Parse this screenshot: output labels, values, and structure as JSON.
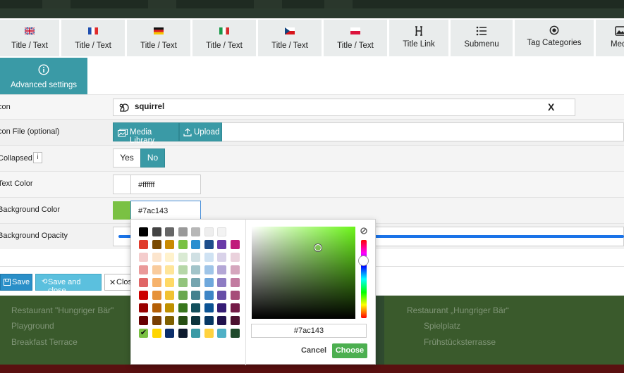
{
  "tabs": [
    {
      "label": "Title / Text",
      "icon": "flag-uk-icon"
    },
    {
      "label": "Title / Text",
      "icon": "flag-fr-icon"
    },
    {
      "label": "Title / Text",
      "icon": "flag-de-icon"
    },
    {
      "label": "Title / Text",
      "icon": "flag-it-icon"
    },
    {
      "label": "Title / Text",
      "icon": "flag-cz-icon"
    },
    {
      "label": "Title / Text",
      "icon": "flag-pl-icon"
    },
    {
      "label": "Title Link",
      "icon": "heading-icon"
    },
    {
      "label": "Submenu",
      "icon": "list-icon"
    },
    {
      "label": "Tag Categories",
      "icon": "dot-circle-icon"
    },
    {
      "label": "Med",
      "icon": "image-icon"
    }
  ],
  "advanced_tab": {
    "label": "Advanced settings",
    "icon": "info-icon"
  },
  "form": {
    "icon": {
      "label": "con",
      "value": "squirrel",
      "clear": "X"
    },
    "icon_file": {
      "label": "con File (optional)",
      "media_library": "Media Library",
      "upload": "Upload"
    },
    "collapsed": {
      "label": "Collapsed",
      "info": "i",
      "yes": "Yes",
      "no": "No",
      "selected": "No"
    },
    "text_color": {
      "label": "Text Color",
      "value": "#ffffff"
    },
    "background_color": {
      "label": "Background Color",
      "value": "#7ac143"
    },
    "background_opacity": {
      "label": "Background Opacity"
    }
  },
  "footer": {
    "save": "Save",
    "save_close": "Save and close",
    "close": "Close"
  },
  "picker": {
    "hex_value": "#7ac143",
    "cancel": "Cancel",
    "choose": "Choose",
    "clear_icon": "no-color-icon",
    "palette": [
      [
        "#000000",
        "#434343",
        "#666666",
        "#999999",
        "#b7b7b7",
        "#eeeeee",
        "#f3f3f3"
      ],
      [
        "#e03b2b",
        "#7a4a00",
        "#c98a00",
        "#7ac143",
        "#2a8fd0",
        "#1e4e8c",
        "#6a3aa8",
        "#c01a7a"
      ],
      [
        "#f4cccc",
        "#fce5cd",
        "#fff2cc",
        "#d9ead3",
        "#d0e0e3",
        "#cfe2f3",
        "#d9d2e9",
        "#ead1dc"
      ],
      [
        "#ea9999",
        "#f9cb9c",
        "#ffe599",
        "#b6d7a8",
        "#a2c4c9",
        "#9fc5e8",
        "#b4a7d6",
        "#d5a6bd"
      ],
      [
        "#e06666",
        "#f6b26b",
        "#ffd966",
        "#93c47d",
        "#76a5af",
        "#6fa8dc",
        "#8e7cc3",
        "#c27ba0"
      ],
      [
        "#cc0000",
        "#e69138",
        "#f1c232",
        "#6aa84f",
        "#45818e",
        "#3d85c6",
        "#674ea7",
        "#a64d79"
      ],
      [
        "#990000",
        "#b45f06",
        "#bf9000",
        "#38761d",
        "#134f5c",
        "#0b5394",
        "#351c75",
        "#741b47"
      ],
      [
        "#660000",
        "#783f04",
        "#7f6000",
        "#274e13",
        "#0c343d",
        "#073763",
        "#20124d",
        "#4c1130"
      ],
      [
        "#7ac143",
        "#ffd500",
        "#0b2e6b",
        "#0d1a2e",
        "#3a9aa6",
        "#ffd23f",
        "#4fb0c6",
        "#1f4a2c"
      ]
    ]
  },
  "background_map": {
    "left_items": [
      "Restaurant \"Hungriger Bär\"",
      "Playground",
      "Breakfast Terrace"
    ],
    "right_items": [
      "Restaurant „Hungriger Bär“",
      "Spielplatz",
      "Frühstücksterrasse"
    ]
  },
  "colors": {
    "accent": "#3a9aa6",
    "choose_green": "#4caf50",
    "selected_color": "#7ac143"
  }
}
